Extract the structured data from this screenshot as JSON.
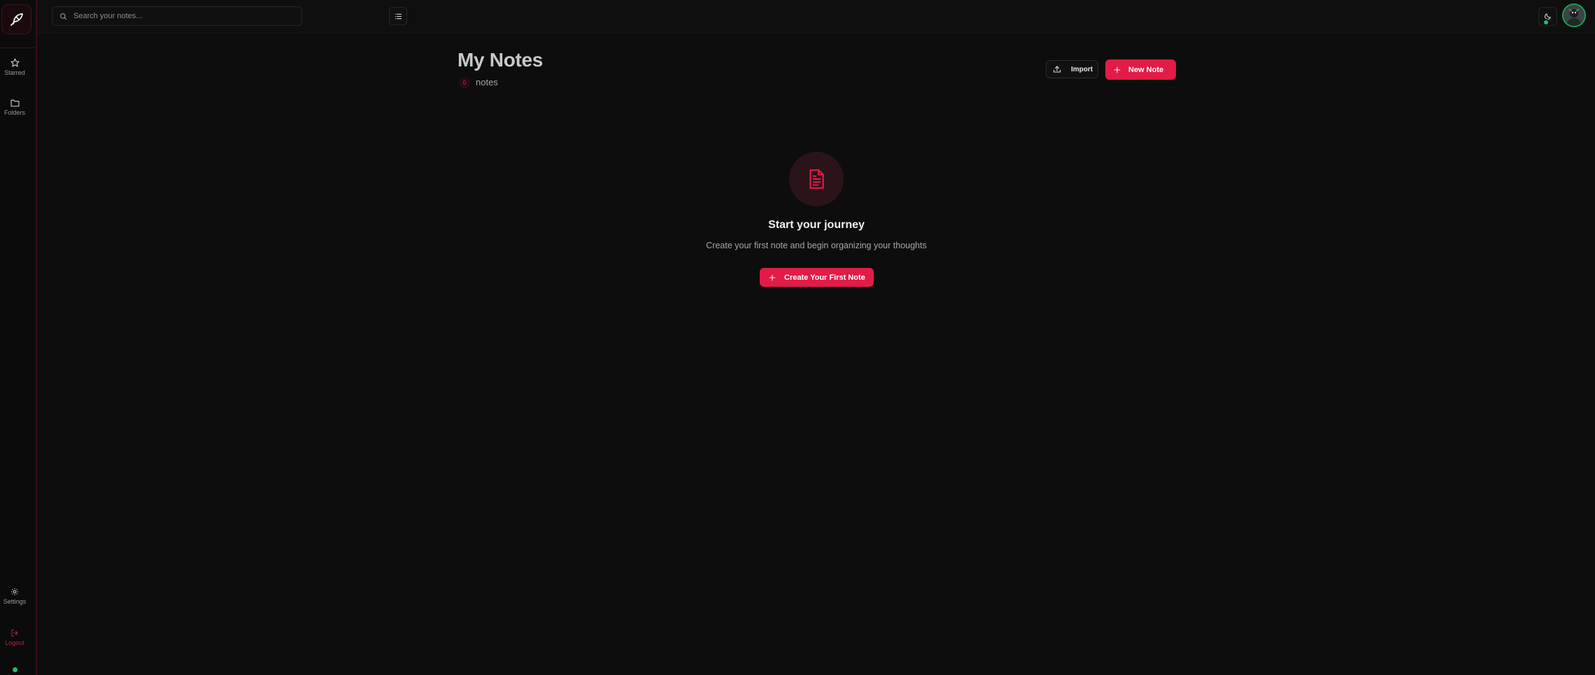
{
  "colors": {
    "accent": "#e21b47",
    "background": "#0d0d0d",
    "status_online": "#1fbf6a"
  },
  "sidebar": {
    "logo_icon": "feather-logo-icon",
    "items": [
      {
        "label": "Starred",
        "icon": "star-icon"
      },
      {
        "label": "Folders",
        "icon": "folder-icon"
      },
      {
        "label": "Settings",
        "icon": "gear-icon"
      },
      {
        "label": "Logout",
        "icon": "logout-icon"
      }
    ]
  },
  "topbar": {
    "search_placeholder": "Search your notes...",
    "view_toggle_icon": "list-icon",
    "theme_toggle_icon": "moon-icon"
  },
  "header": {
    "title": "My Notes",
    "count": "0",
    "count_label": "notes",
    "import_label": "Import",
    "new_note_label": "New Note"
  },
  "empty_state": {
    "icon": "document-icon",
    "title": "Start your journey",
    "subtitle": "Create your first note and begin organizing your thoughts",
    "cta_label": "Create Your First Note"
  }
}
